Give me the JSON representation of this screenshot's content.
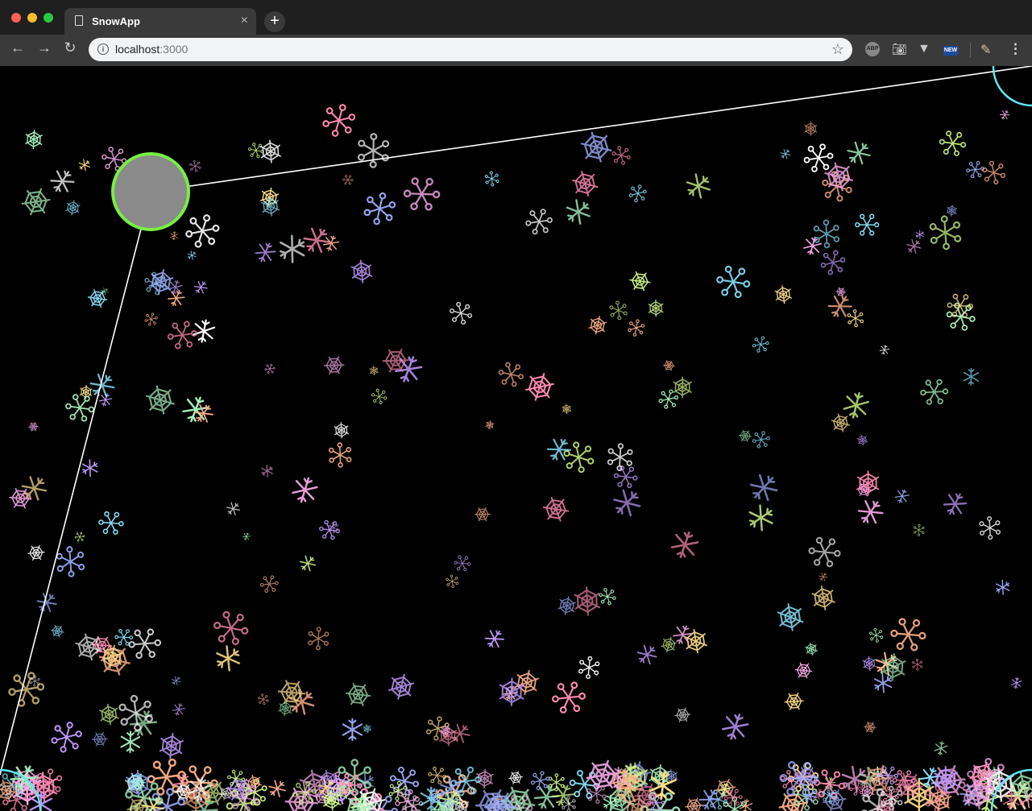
{
  "browser": {
    "tab_title": "SnowApp",
    "tab_close": "×",
    "new_tab": "+",
    "url_host": "localhost",
    "url_port": ":3000",
    "bookmark_star": "☆",
    "extensions": [
      {
        "name": "adblock-plus",
        "label": "ABP"
      },
      {
        "name": "screenshot",
        "label": ""
      },
      {
        "name": "vue-devtools",
        "label": ""
      },
      {
        "name": "new-extension",
        "label": "NEW"
      },
      {
        "name": "pen-extension",
        "label": ""
      }
    ],
    "nav": {
      "back": "←",
      "forward": "→",
      "reload": "↻",
      "menu": "⋮"
    }
  },
  "scene": {
    "background_color": "#000000",
    "handle_fill": "#8a8a8a",
    "handle_stroke": "#77ee44",
    "corner_handle_stroke": "#5ee8f0",
    "line_color": "#ffffff",
    "snowflake_palette": [
      "#ffffff",
      "#f6a8e8",
      "#a8f6c0",
      "#9fb0ff",
      "#ffe08a",
      "#ffb28a",
      "#c19bff",
      "#8ae6ff",
      "#ff8ab4",
      "#d8ff8a"
    ]
  }
}
